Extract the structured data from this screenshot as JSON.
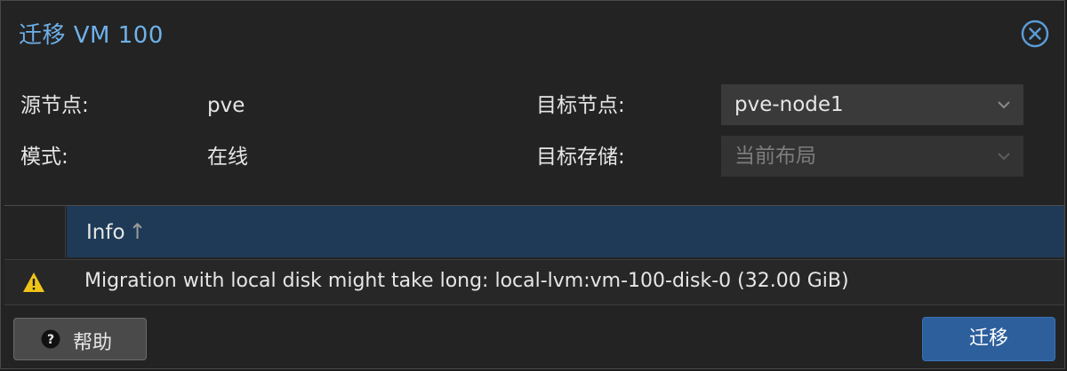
{
  "dialog": {
    "title": "迁移 VM 100"
  },
  "form": {
    "source_node_label": "源节点:",
    "source_node_value": "pve",
    "mode_label": "模式:",
    "mode_value": "在线",
    "target_node_label": "目标节点:",
    "target_node_value": "pve-node1",
    "target_storage_label": "目标存储:",
    "target_storage_value": "当前布局"
  },
  "grid": {
    "column_header": "Info",
    "sort_arrow": "↑",
    "rows": [
      {
        "icon": "warning-icon",
        "text": "Migration with local disk might take long: local-lvm:vm-100-disk-0 (32.00 GiB)"
      }
    ]
  },
  "buttons": {
    "help_label": "帮助",
    "migrate_label": "迁移"
  },
  "colors": {
    "accent": "#6eb1ea",
    "header_selected": "#1f3a57",
    "primary_button": "#2d5f9c",
    "warning": "#f0c419"
  }
}
